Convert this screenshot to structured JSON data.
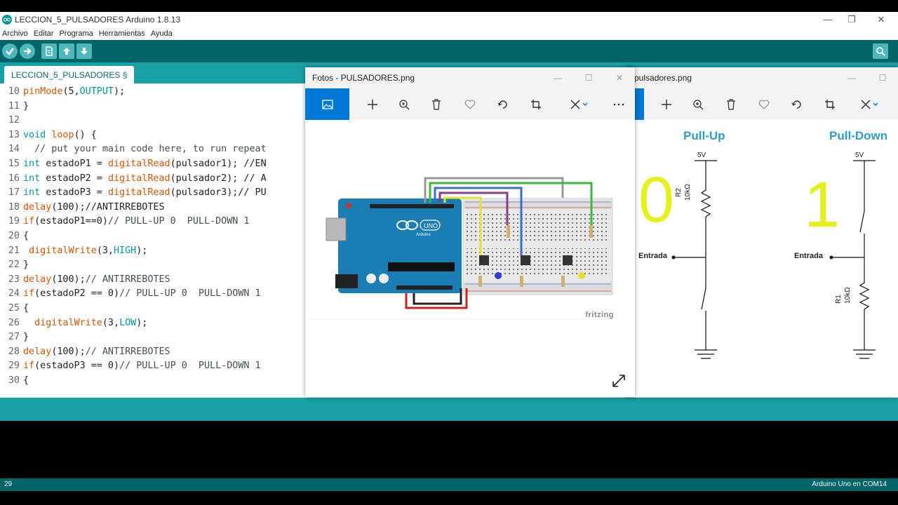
{
  "ide": {
    "title": "LECCION_5_PULSADORES Arduino 1.8.13",
    "menu": [
      "Archivo",
      "Editar",
      "Programa",
      "Herramientas",
      "Ayuda"
    ],
    "tab_label": "LECCION_5_PULSADORES §",
    "toolbar": [
      "verify-icon",
      "upload-icon",
      "new-icon",
      "open-icon",
      "save-icon",
      "serial-monitor-icon"
    ],
    "code_lines": [
      {
        "n": "10",
        "parts": [
          {
            "t": "pinMode",
            "c": "fn"
          },
          {
            "t": "(5,",
            "c": "plain"
          },
          {
            "t": "OUTPUT",
            "c": "cst"
          },
          {
            "t": ");",
            "c": "plain"
          }
        ]
      },
      {
        "n": "11",
        "parts": [
          {
            "t": "}",
            "c": "plain"
          }
        ]
      },
      {
        "n": "12",
        "parts": []
      },
      {
        "n": "13",
        "parts": [
          {
            "t": "void",
            "c": "kw"
          },
          {
            "t": " ",
            "c": "plain"
          },
          {
            "t": "loop",
            "c": "fn"
          },
          {
            "t": "() {",
            "c": "plain"
          }
        ]
      },
      {
        "n": "14",
        "parts": [
          {
            "t": "  // put your main code here, to run repeat",
            "c": "cm"
          }
        ]
      },
      {
        "n": "15",
        "parts": [
          {
            "t": "int",
            "c": "kw"
          },
          {
            "t": " estadoP1 = ",
            "c": "plain"
          },
          {
            "t": "digitalRead",
            "c": "fn"
          },
          {
            "t": "(pulsador1); //EN",
            "c": "plain"
          }
        ]
      },
      {
        "n": "16",
        "parts": [
          {
            "t": "int",
            "c": "kw"
          },
          {
            "t": " estadoP2 = ",
            "c": "plain"
          },
          {
            "t": "digitalRead",
            "c": "fn"
          },
          {
            "t": "(pulsador2); // A",
            "c": "plain"
          }
        ]
      },
      {
        "n": "17",
        "parts": [
          {
            "t": "int",
            "c": "kw"
          },
          {
            "t": " estadoP3 = ",
            "c": "plain"
          },
          {
            "t": "digitalRead",
            "c": "fn"
          },
          {
            "t": "(pulsador3);// PU",
            "c": "plain"
          }
        ]
      },
      {
        "n": "18",
        "parts": [
          {
            "t": "delay",
            "c": "fn"
          },
          {
            "t": "(100);//ANTIRREBOTES",
            "c": "plain"
          }
        ]
      },
      {
        "n": "19",
        "parts": [
          {
            "t": "if",
            "c": "fn"
          },
          {
            "t": "(estadoP1==0)",
            "c": "plain"
          },
          {
            "t": "// PULL-UP 0  PULL-DOWN 1",
            "c": "cm"
          }
        ]
      },
      {
        "n": "20",
        "parts": [
          {
            "t": "{",
            "c": "plain"
          }
        ]
      },
      {
        "n": "21",
        "parts": [
          {
            "t": " ",
            "c": "plain"
          },
          {
            "t": "digitalWrite",
            "c": "fn"
          },
          {
            "t": "(3,",
            "c": "plain"
          },
          {
            "t": "HIGH",
            "c": "cst"
          },
          {
            "t": ");",
            "c": "plain"
          }
        ]
      },
      {
        "n": "22",
        "parts": [
          {
            "t": "}",
            "c": "plain"
          }
        ]
      },
      {
        "n": "23",
        "parts": [
          {
            "t": "delay",
            "c": "fn"
          },
          {
            "t": "(100);",
            "c": "plain"
          },
          {
            "t": "// ANTIRREBOTES",
            "c": "cm"
          }
        ]
      },
      {
        "n": "24",
        "parts": [
          {
            "t": "if",
            "c": "fn"
          },
          {
            "t": "(estadoP2 == 0)",
            "c": "plain"
          },
          {
            "t": "// PULL-UP 0  PULL-DOWN 1",
            "c": "cm"
          }
        ]
      },
      {
        "n": "25",
        "parts": [
          {
            "t": "{",
            "c": "plain"
          }
        ]
      },
      {
        "n": "26",
        "parts": [
          {
            "t": "  ",
            "c": "plain"
          },
          {
            "t": "digitalWrite",
            "c": "fn"
          },
          {
            "t": "(3,",
            "c": "plain"
          },
          {
            "t": "LOW",
            "c": "cst"
          },
          {
            "t": ");",
            "c": "plain"
          }
        ]
      },
      {
        "n": "27",
        "parts": [
          {
            "t": "}",
            "c": "plain"
          }
        ]
      },
      {
        "n": "28",
        "parts": [
          {
            "t": "delay",
            "c": "fn"
          },
          {
            "t": "(100);",
            "c": "plain"
          },
          {
            "t": "// ANTIRREBOTES",
            "c": "cm"
          }
        ]
      },
      {
        "n": "29",
        "parts": [
          {
            "t": "if",
            "c": "fn"
          },
          {
            "t": "(estadoP3 == 0)",
            "c": "plain"
          },
          {
            "t": "// PULL-UP 0  PULL-DOWN 1",
            "c": "cm"
          }
        ]
      },
      {
        "n": "30",
        "parts": [
          {
            "t": "{",
            "c": "plain"
          }
        ]
      }
    ],
    "footer_line": "29",
    "footer_board": "Arduino Uno en COM14"
  },
  "photo1": {
    "title": "Fotos - PULSADORES.png",
    "tools": [
      "image-icon",
      "add-icon",
      "zoom-in-icon",
      "delete-icon",
      "favorite-icon",
      "rotate-icon",
      "crop-icon",
      "edit-icon",
      "more-icon"
    ],
    "watermark": "fritzing",
    "board_label": "UNO",
    "board_sub": "Arduino"
  },
  "photo2": {
    "title": "pulsadores.png",
    "pullup_title": "Pull-Up",
    "pulldown_title": "Pull-Down",
    "pullup_value": "0",
    "pulldown_value": "1",
    "vcc_label": "5V",
    "input_label": "Entrada",
    "r2_label": "R2",
    "r2_value": "10kΩ",
    "r1_label": "R1",
    "r1_value": "10kΩ",
    "accent": "#2aa0c8",
    "value_color": "#e6f01e"
  }
}
